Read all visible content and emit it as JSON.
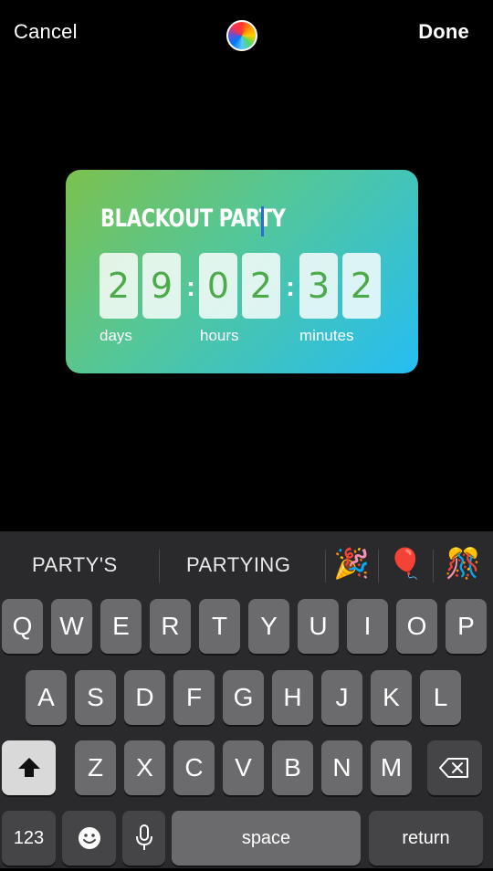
{
  "header": {
    "cancel_label": "Cancel",
    "done_label": "Done",
    "color_picker_icon": "color-wheel-icon"
  },
  "countdown": {
    "title": "BLACKOUT PARTY",
    "digits": [
      "2",
      "9",
      "0",
      "2",
      "3",
      "2"
    ],
    "separator": ":",
    "units": [
      "days",
      "hours",
      "minutes"
    ],
    "gradient": [
      "#7cc14e",
      "#52c79c",
      "#25bdf3"
    ]
  },
  "keyboard": {
    "suggestions": [
      "PARTY'S",
      "PARTYING"
    ],
    "emoji_suggestions": [
      "🎉",
      "🎈",
      "🎊"
    ],
    "row1": [
      "Q",
      "W",
      "E",
      "R",
      "T",
      "Y",
      "U",
      "I",
      "O",
      "P"
    ],
    "row2": [
      "A",
      "S",
      "D",
      "F",
      "G",
      "H",
      "J",
      "K",
      "L"
    ],
    "row3": [
      "Z",
      "X",
      "C",
      "V",
      "B",
      "N",
      "M"
    ],
    "shift_icon": "shift-icon",
    "delete_icon": "backspace-icon",
    "numbers_label": "123",
    "emoji_icon": "emoji-icon",
    "mic_icon": "microphone-icon",
    "space_label": "space",
    "return_label": "return"
  }
}
